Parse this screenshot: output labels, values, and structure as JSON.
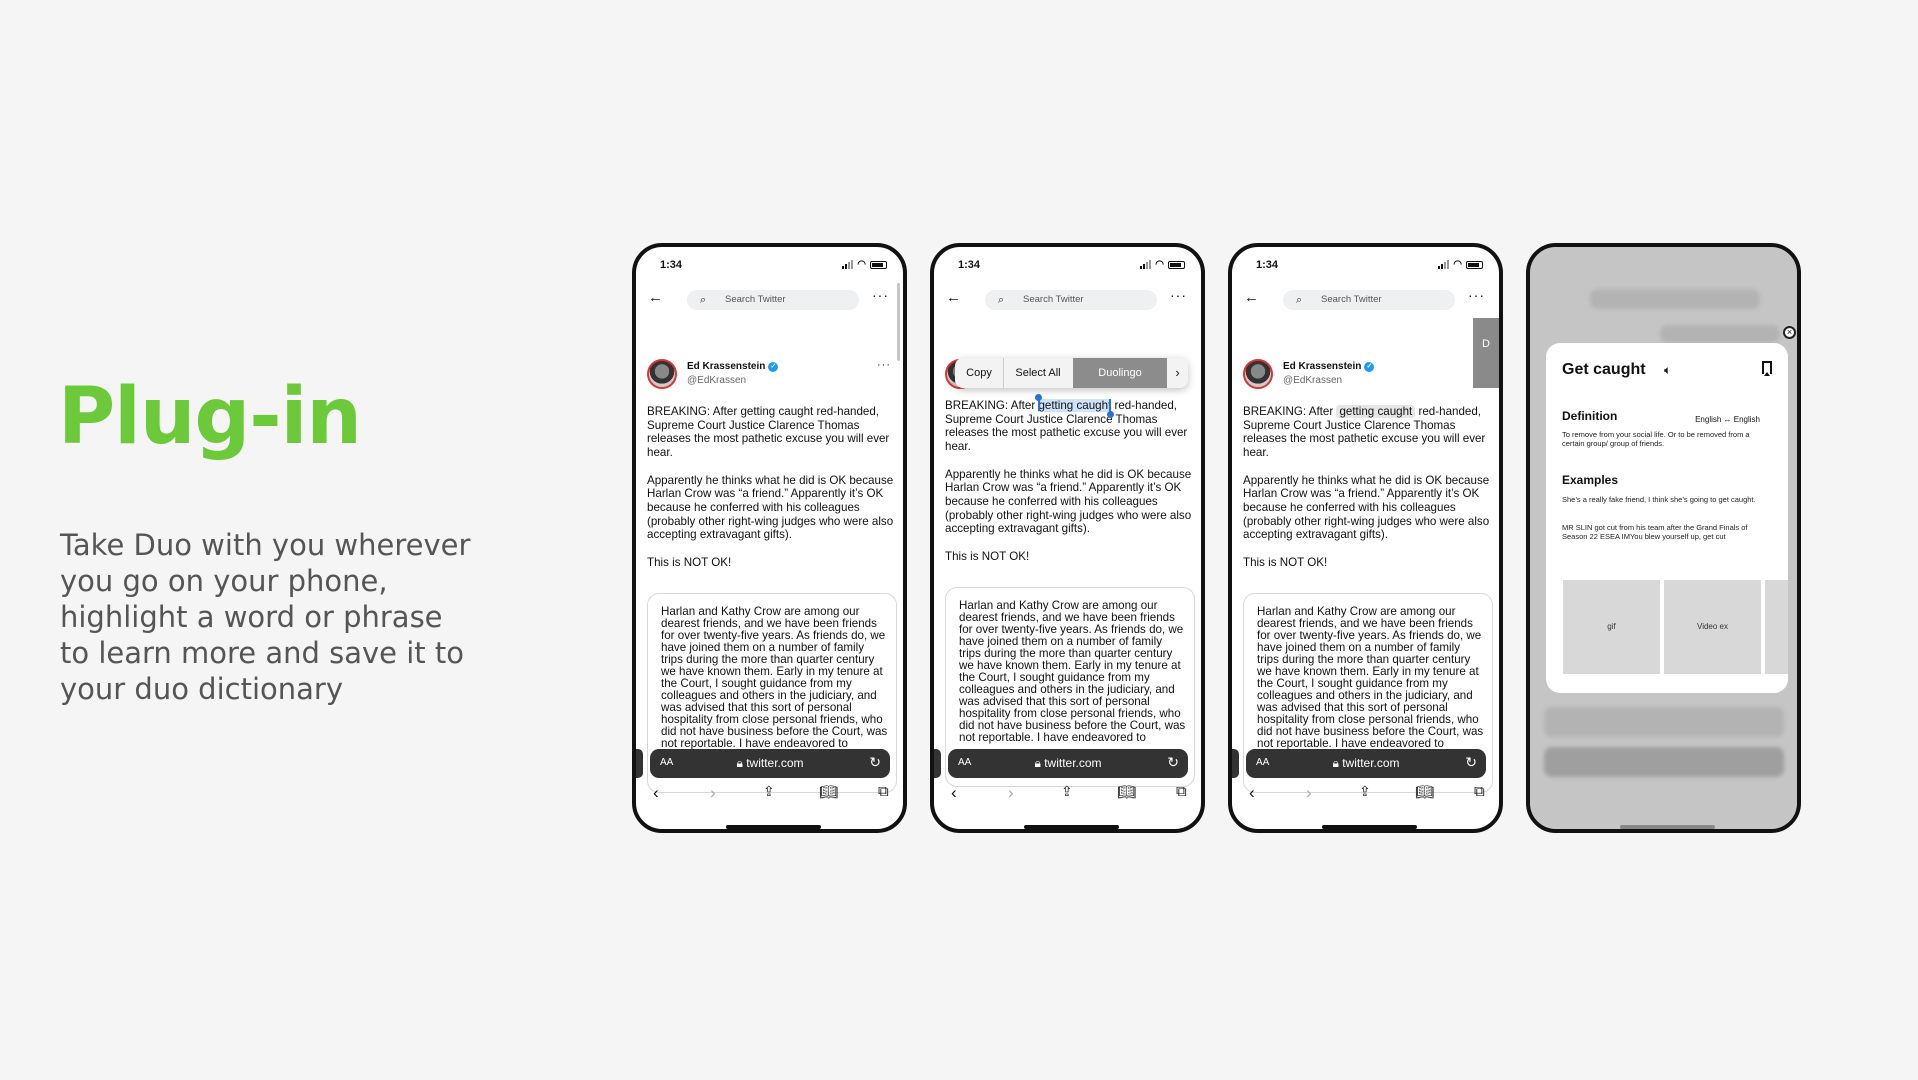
{
  "slide": {
    "title": "Plug-in",
    "description": "Take Duo with you wherever you go on your phone, highlight a word or phrase to learn more and save it to your duo dictionary"
  },
  "phone": {
    "time": "1:34",
    "search_placeholder": "Search Twitter",
    "tweet_author": "Ed Krassenstein",
    "tweet_handle": "@EdKrassen",
    "tweet_line1_before": "BREAKING: After ",
    "tweet_phrase": "getting caught",
    "tweet_line1_after": " red-handed, Supreme Court Justice Clarence Thomas releases the most pathetic excuse you will ever hear.",
    "tweet_para2": "Apparently he thinks what he did is OK because Harlan Crow was “a friend.” Apparently it’s OK because he conferred with his colleagues (probably other right-wing judges who were also accepting extravagant gifts).",
    "tweet_para3": "This is NOT OK!",
    "quote_text": "Harlan and Kathy Crow are among our dearest friends, and we have been friends for over twenty-five years. As friends do, we have joined them on a number of family trips during the more than quarter century we have known them. Early in my tenure at the Court, I sought guidance from my colleagues and others in the judiciary, and was advised that this sort of personal hospitality from close personal friends, who did not have business before the Court, was not reportable. I have endeavored to",
    "address_aa": "AA",
    "address_url": "twitter.com",
    "context_menu": {
      "copy": "Copy",
      "select_all": "Select All",
      "duolingo": "Duolingo",
      "next": "›"
    },
    "side_tab": "D"
  },
  "dictionary": {
    "word": "Get caught",
    "definition_heading": "Definition",
    "language_pair": "English ↔ English",
    "definition_text": "To remove from your social life. Or to be removed from a certain group/ group of friends.",
    "examples_heading": "Examples",
    "example_1": "She’s a really fake friend, I think she’s going to get caught.",
    "example_2": "MR SLIN got cut from his team after the Grand Finals of Season 22 ESEA IMYou blew yourself up, get cut",
    "tile_1": "gif",
    "tile_2": "Video ex"
  },
  "colors": {
    "accent_green": "#6cc93a",
    "selection_blue": "#2a6fdb",
    "verified_blue": "#1d9bf0"
  },
  "icons": [
    "back-arrow-icon",
    "search-icon",
    "more-icon",
    "verified-icon",
    "lock-icon",
    "reload-icon",
    "chevron-left-icon",
    "chevron-right-icon",
    "share-icon",
    "book-icon",
    "tabs-icon",
    "speaker-icon",
    "bookmark-icon",
    "close-icon"
  ]
}
